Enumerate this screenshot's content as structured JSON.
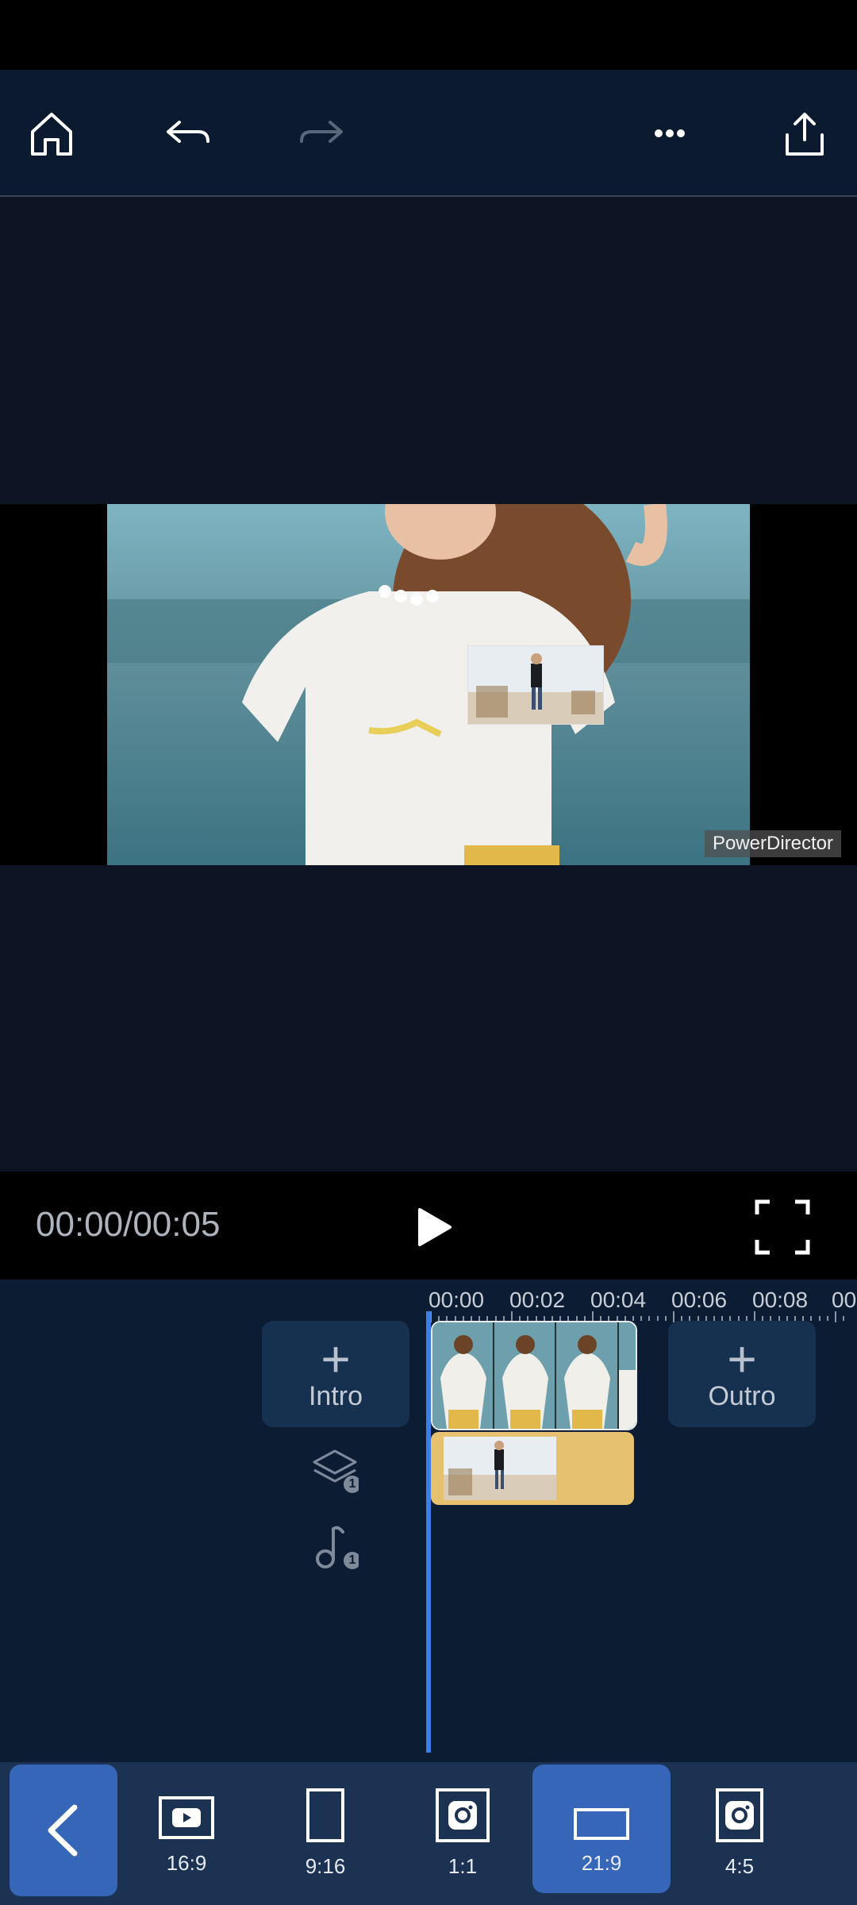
{
  "toolbar": {
    "icons": [
      "home-icon",
      "undo-icon",
      "redo-icon",
      "more-icon",
      "share-icon"
    ]
  },
  "preview": {
    "watermark": "PowerDirector"
  },
  "playback": {
    "time": "00:00/00:05"
  },
  "timeline": {
    "ruler": [
      "00:00",
      "00:02",
      "00:04",
      "00:06",
      "00:08",
      "00"
    ],
    "intro_label": "Intro",
    "outro_label": "Outro",
    "overlay_count": "1",
    "audio_count": "1"
  },
  "aspect_ratios": [
    {
      "label": "16:9",
      "icon": "youtube-icon"
    },
    {
      "label": "9:16",
      "icon": "portrait-frame-icon"
    },
    {
      "label": "1:1",
      "icon": "instagram-icon"
    },
    {
      "label": "21:9",
      "icon": "widescreen-frame-icon",
      "selected": true
    },
    {
      "label": "4:5",
      "icon": "instagram-icon"
    }
  ],
  "colors": {
    "accent": "#3566b8",
    "playhead": "#3c7fe6",
    "overlay_track": "#e6c270"
  }
}
